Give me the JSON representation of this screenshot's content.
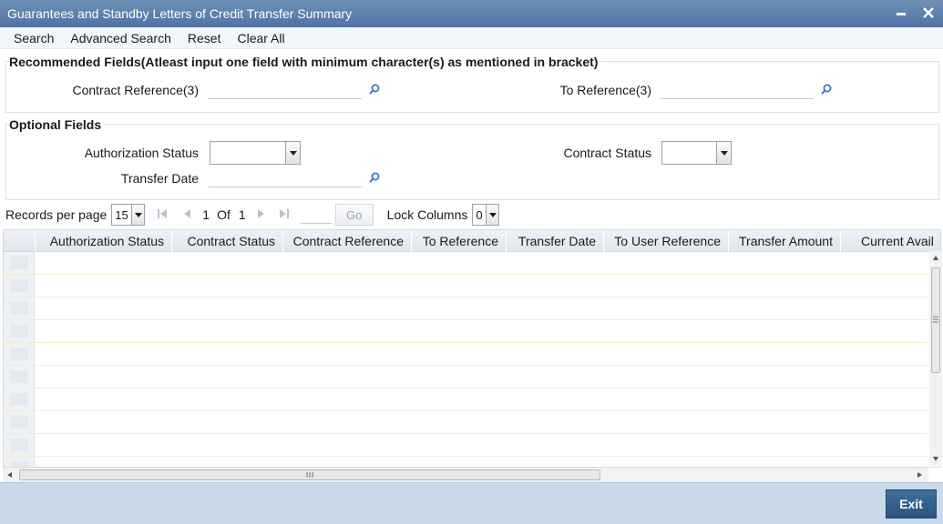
{
  "window": {
    "title": "Guarantees and Standby Letters of Credit Transfer Summary",
    "minimize_icon": "minimize-icon",
    "close_icon": "close-icon"
  },
  "menu": {
    "items": [
      "Search",
      "Advanced Search",
      "Reset",
      "Clear All"
    ]
  },
  "recommended": {
    "legend": "Recommended Fields(Atleast input one field with minimum character(s) as mentioned in bracket)",
    "contract_reference_label": "Contract Reference(3)",
    "contract_reference_value": "",
    "to_reference_label": "To Reference(3)",
    "to_reference_value": ""
  },
  "optional": {
    "legend": "Optional Fields",
    "authorization_status_label": "Authorization Status",
    "authorization_status_value": "",
    "contract_status_label": "Contract Status",
    "contract_status_value": "",
    "transfer_date_label": "Transfer Date",
    "transfer_date_value": ""
  },
  "pager": {
    "records_per_page_label": "Records per page",
    "records_per_page": "15",
    "current_page": "1",
    "of_label": "Of",
    "total_pages": "1",
    "go_label": "Go",
    "lock_columns_label": "Lock Columns",
    "lock_columns": "0"
  },
  "grid": {
    "columns": [
      "Authorization Status",
      "Contract Status",
      "Contract Reference",
      "To Reference",
      "Transfer Date",
      "To User Reference",
      "Transfer Amount",
      "Current Avail"
    ],
    "rows": []
  },
  "footer": {
    "exit_label": "Exit"
  },
  "colors": {
    "titlebar": "#5b7fad",
    "footer": "#c9d9ea",
    "exit_button": "#33628e"
  }
}
